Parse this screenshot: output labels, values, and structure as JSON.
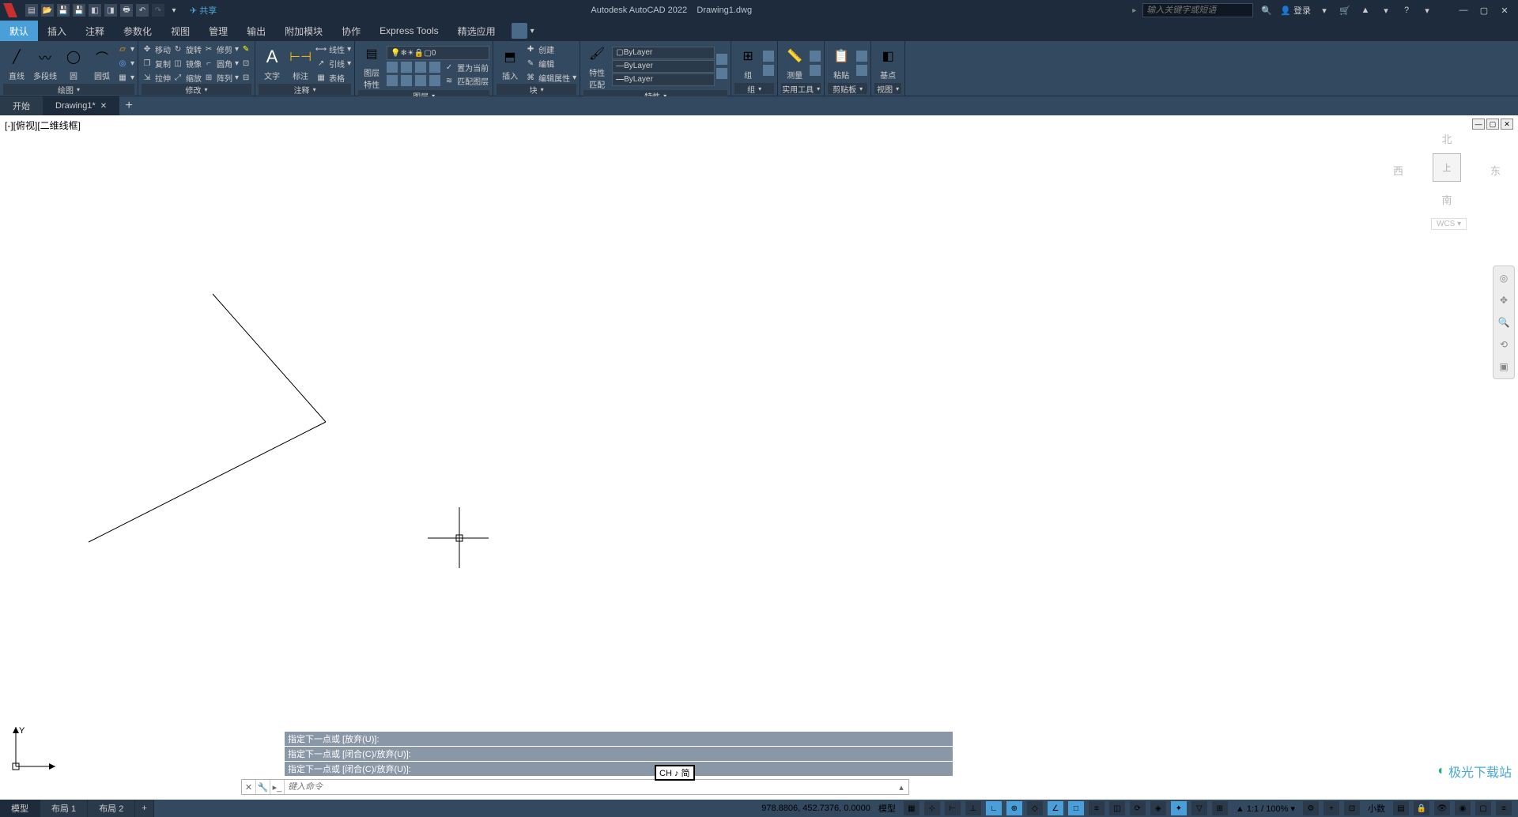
{
  "title": {
    "app": "Autodesk AutoCAD 2022",
    "file": "Drawing1.dwg"
  },
  "qat": {
    "share": "共享"
  },
  "search": {
    "placeholder": "输入关键字或短语"
  },
  "login": {
    "label": "登录"
  },
  "menubar": {
    "tabs": [
      "默认",
      "插入",
      "注释",
      "参数化",
      "视图",
      "管理",
      "输出",
      "附加模块",
      "协作",
      "Express Tools",
      "精选应用"
    ]
  },
  "ribbon": {
    "draw": {
      "label": "绘图",
      "tools": {
        "line": "直线",
        "polyline": "多段线",
        "circle": "圆",
        "arc": "圆弧"
      }
    },
    "modify": {
      "label": "修改",
      "move": "移动",
      "rotate": "旋转",
      "trim": "修剪",
      "copy": "复制",
      "mirror": "镜像",
      "fillet": "圆角",
      "stretch": "拉伸",
      "scale": "缩放",
      "array": "阵列"
    },
    "annotate": {
      "label": "注释",
      "text": "文字",
      "dim": "标注",
      "linear": "线性",
      "leader": "引线",
      "table": "表格"
    },
    "layers": {
      "label": "图层",
      "props": "图层\n特性",
      "current_layer": "0",
      "set_current": "置为当前",
      "match": "匹配图层"
    },
    "block": {
      "label": "块",
      "insert": "插入",
      "create": "创建",
      "edit": "编辑",
      "attrib": "编辑属性"
    },
    "properties": {
      "label": "特性",
      "match": "特性\n匹配",
      "layer": "ByLayer",
      "linetype": "ByLayer",
      "lineweight": "ByLayer"
    },
    "groups": {
      "label": "组",
      "group": "组"
    },
    "utilities": {
      "label": "实用工具",
      "measure": "测量"
    },
    "clipboard": {
      "label": "剪贴板",
      "paste": "粘贴"
    },
    "view": {
      "label": "视图",
      "base": "基点"
    }
  },
  "filetabs": {
    "start": "开始",
    "drawing": "Drawing1*"
  },
  "viewport": {
    "label": "[-][俯视][二维线框]"
  },
  "viewcube": {
    "n": "北",
    "s": "南",
    "e": "东",
    "w": "西",
    "top": "上",
    "wcs": "WCS"
  },
  "command_history": [
    "指定下一点或 [放弃(U)]:",
    "指定下一点或 [闭合(C)/放弃(U)]:",
    "指定下一点或 [闭合(C)/放弃(U)]:"
  ],
  "command_input": {
    "placeholder": "键入命令"
  },
  "layout_tabs": {
    "model": "模型",
    "layout1": "布局 1",
    "layout2": "布局 2"
  },
  "statusbar": {
    "coords": "978.8806, 452.7376, 0.0000",
    "model": "模型",
    "scale": "1:1 / 100%",
    "decimal": "小数"
  },
  "ime": {
    "label": "CH ♪ 简"
  },
  "watermark": {
    "text": "极光下载站"
  }
}
